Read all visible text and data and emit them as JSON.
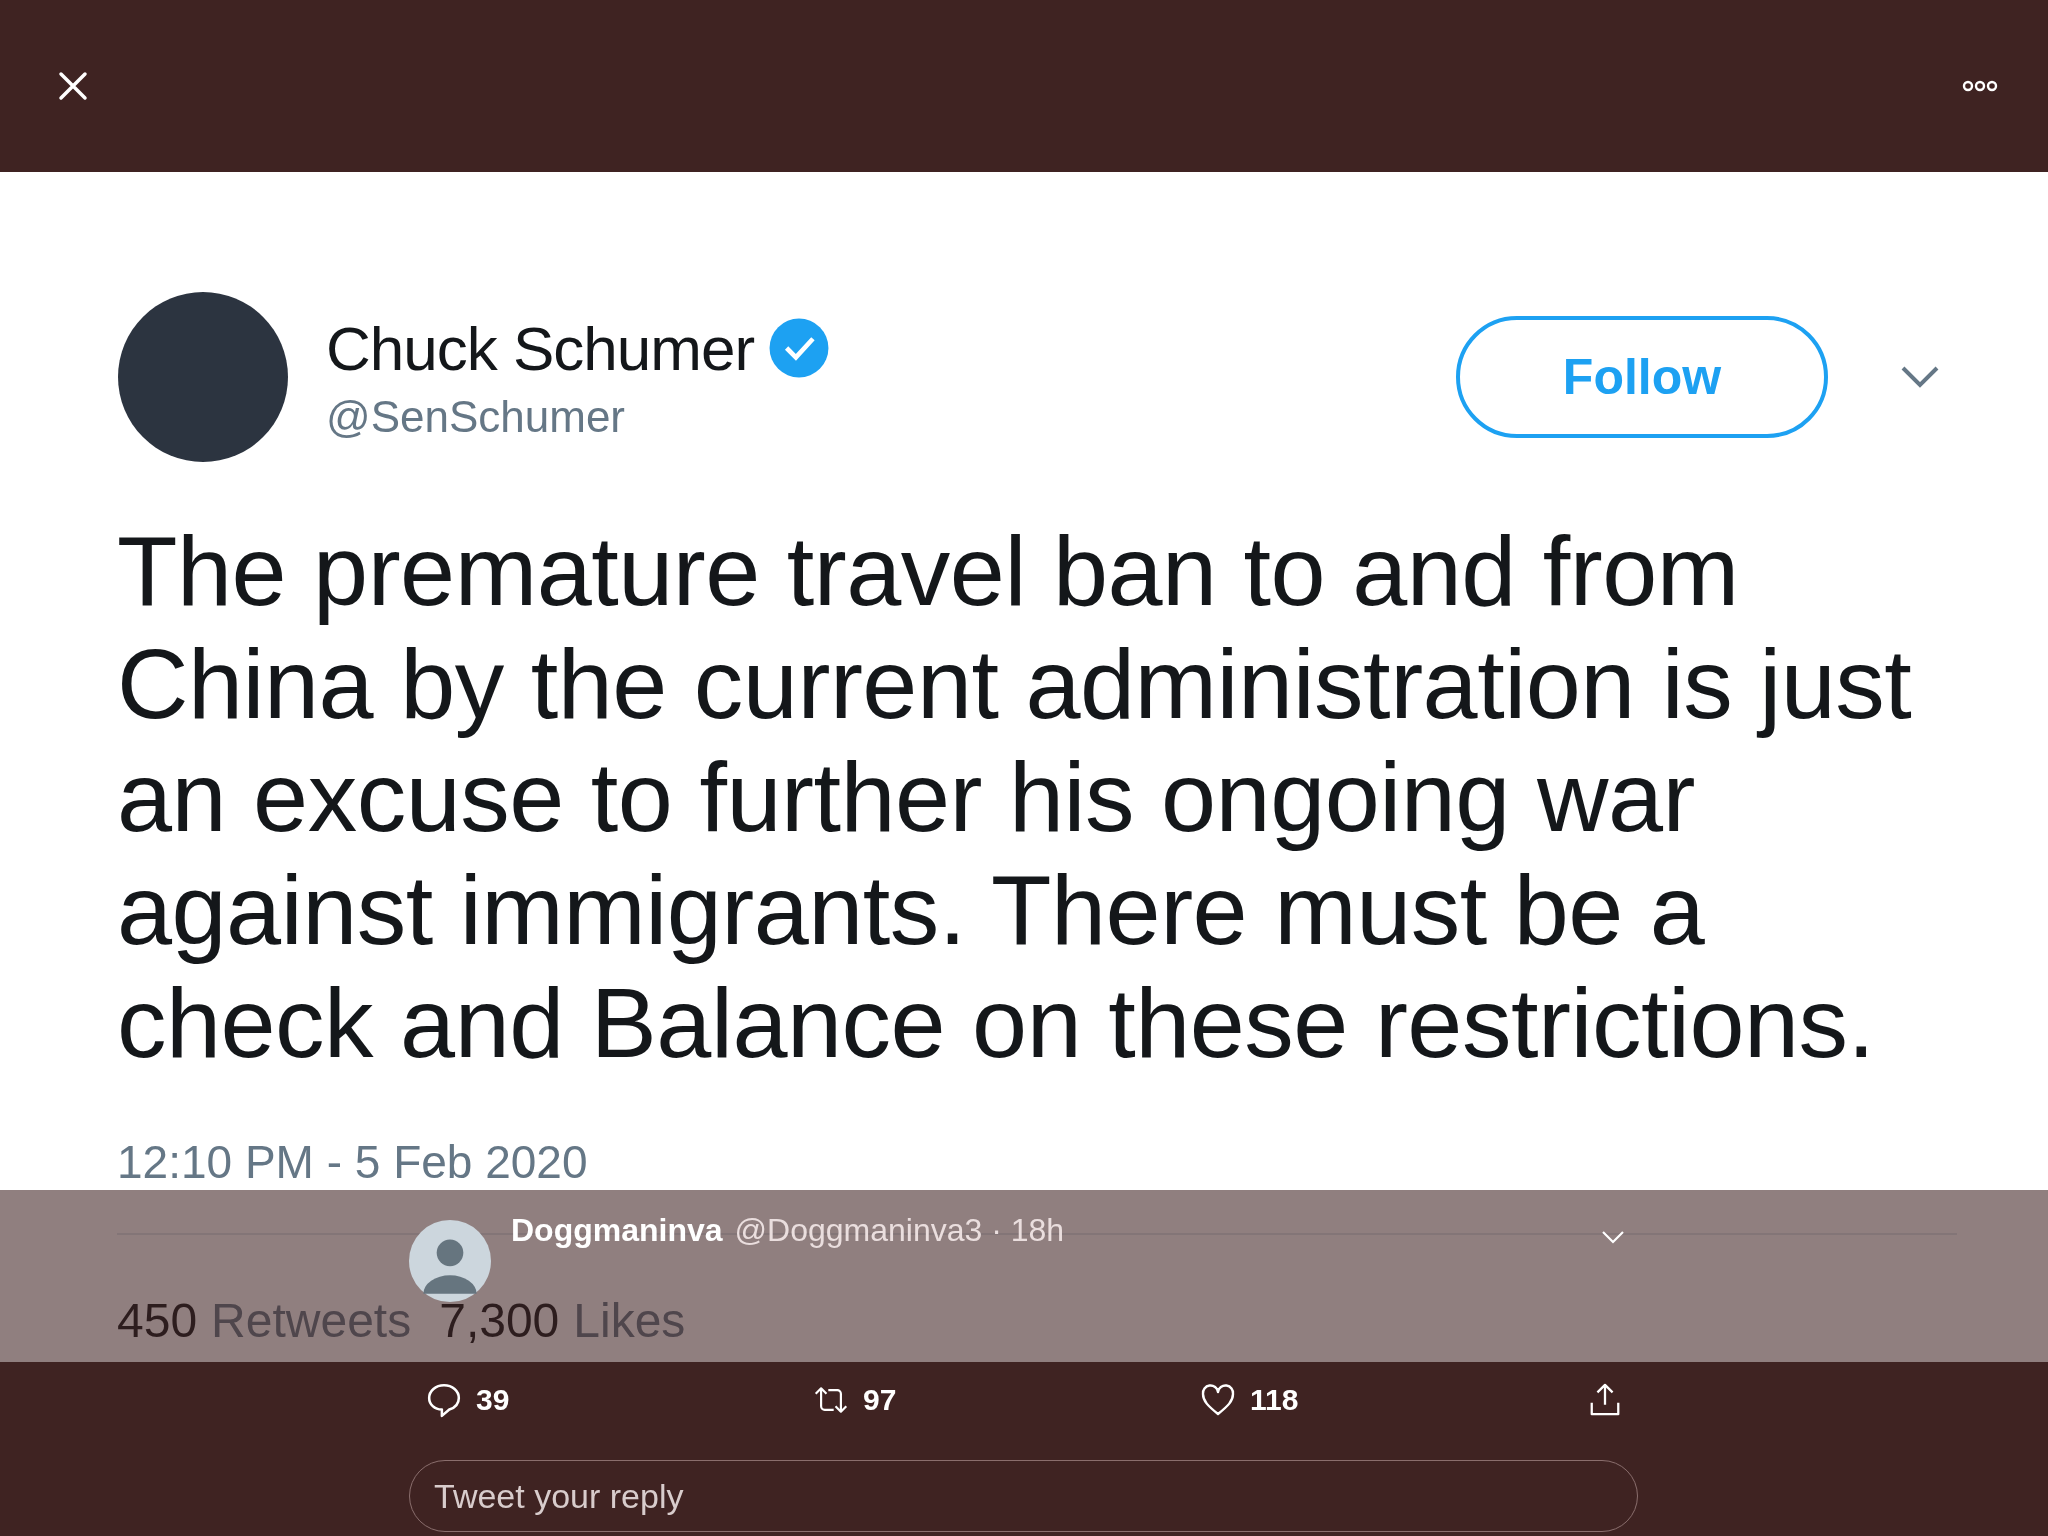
{
  "tweet_image": {
    "name": "Chuck Schumer",
    "verified": true,
    "handle": "@SenSchumer",
    "follow_button": "Follow",
    "text": "The premature travel ban to and from China by the current administration is just an excuse to further his ongoing war against immigrants. There must be a check and Balance on these restrictions.",
    "timestamp": "12:10 PM - 5 Feb 2020",
    "retweets_count": "450",
    "retweets_label": "Retweets",
    "likes_count": "7,300",
    "likes_label": "Likes"
  },
  "reply_tweet": {
    "author": "Doggmaninva",
    "handle_time": "@Doggmaninva3 · 18h"
  },
  "actions": [
    {
      "kind": "reply",
      "count": "39"
    },
    {
      "kind": "retweet",
      "count": "97"
    },
    {
      "kind": "like",
      "count": "118"
    },
    {
      "kind": "share"
    }
  ],
  "reply_field": {
    "placeholder": "Tweet your reply"
  }
}
